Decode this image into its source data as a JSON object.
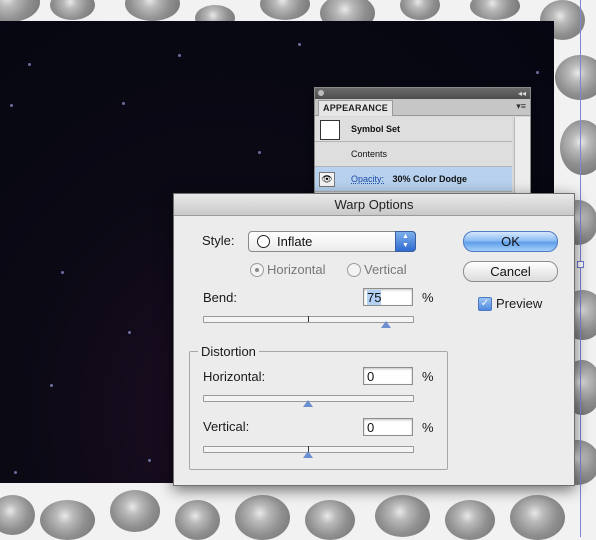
{
  "appearance_panel": {
    "tab_label": "APPEARANCE",
    "rows": [
      {
        "label": "Symbol Set"
      },
      {
        "label": "Contents"
      },
      {
        "attr_label": "Opacity:",
        "attr_value": "30% Color Dodge"
      }
    ]
  },
  "dialog": {
    "title": "Warp Options",
    "style_label": "Style:",
    "style_value": "Inflate",
    "orientation": {
      "horizontal_label": "Horizontal",
      "vertical_label": "Vertical",
      "selected": "Horizontal"
    },
    "bend": {
      "label": "Bend:",
      "value": "75",
      "unit": "%",
      "slider_fraction": 0.75
    },
    "distortion": {
      "title": "Distortion",
      "horizontal": {
        "label": "Horizontal:",
        "value": "0",
        "unit": "%",
        "slider_fraction": 0.5
      },
      "vertical": {
        "label": "Vertical:",
        "value": "0",
        "unit": "%",
        "slider_fraction": 0.5
      }
    },
    "ok_label": "OK",
    "cancel_label": "Cancel",
    "preview_label": "Preview",
    "preview_checked": true
  },
  "colors": {
    "canvas": "#050611",
    "accent_blue": "#5f9eeb",
    "selection_row": "#b7d1ee"
  }
}
